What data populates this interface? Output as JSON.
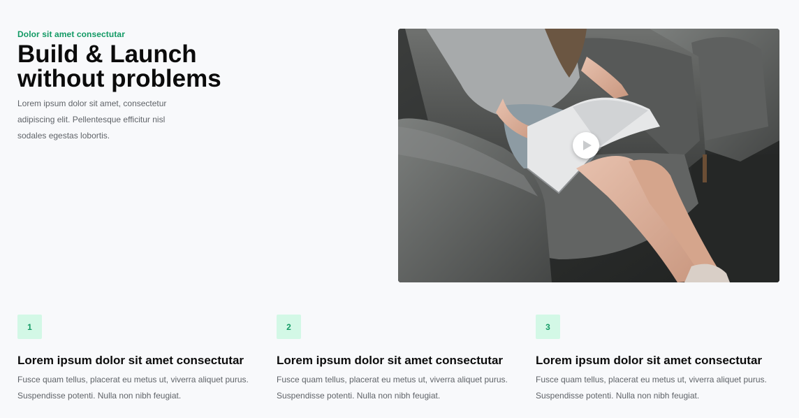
{
  "hero": {
    "eyebrow": "Dolor sit amet consectutar",
    "headline_line1": "Build & Launch",
    "headline_line2": "without problems",
    "intro": "Lorem ipsum dolor sit amet, consectetur adipiscing elit. Pellentesque efficitur nisl sodales egestas lobortis."
  },
  "media": {
    "icon": "play-icon",
    "colors": {
      "play_bg": "#ffffff",
      "play_glyph": "#c9cbcd"
    }
  },
  "features": [
    {
      "number": "1",
      "title": "Lorem ipsum dolor sit amet consectutar",
      "desc_line1": "Fusce quam tellus, placerat eu metus ut, viverra aliquet purus.",
      "desc_line2": "Suspendisse potenti. Nulla non nibh feugiat."
    },
    {
      "number": "2",
      "title": "Lorem ipsum dolor sit amet consectutar",
      "desc_line1": "Fusce quam tellus, placerat eu metus ut, viverra aliquet purus.",
      "desc_line2": "Suspendisse potenti. Nulla non nibh feugiat."
    },
    {
      "number": "3",
      "title": "Lorem ipsum dolor sit amet consectutar",
      "desc_line1": "Fusce quam tellus, placerat eu metus ut, viverra aliquet purus.",
      "desc_line2": "Suspendisse potenti. Nulla non nibh feugiat."
    }
  ],
  "colors": {
    "accent": "#129a64",
    "badge_bg": "#d3f8e6",
    "page_bg": "#f8f9fb",
    "body_text": "#5f6368"
  }
}
